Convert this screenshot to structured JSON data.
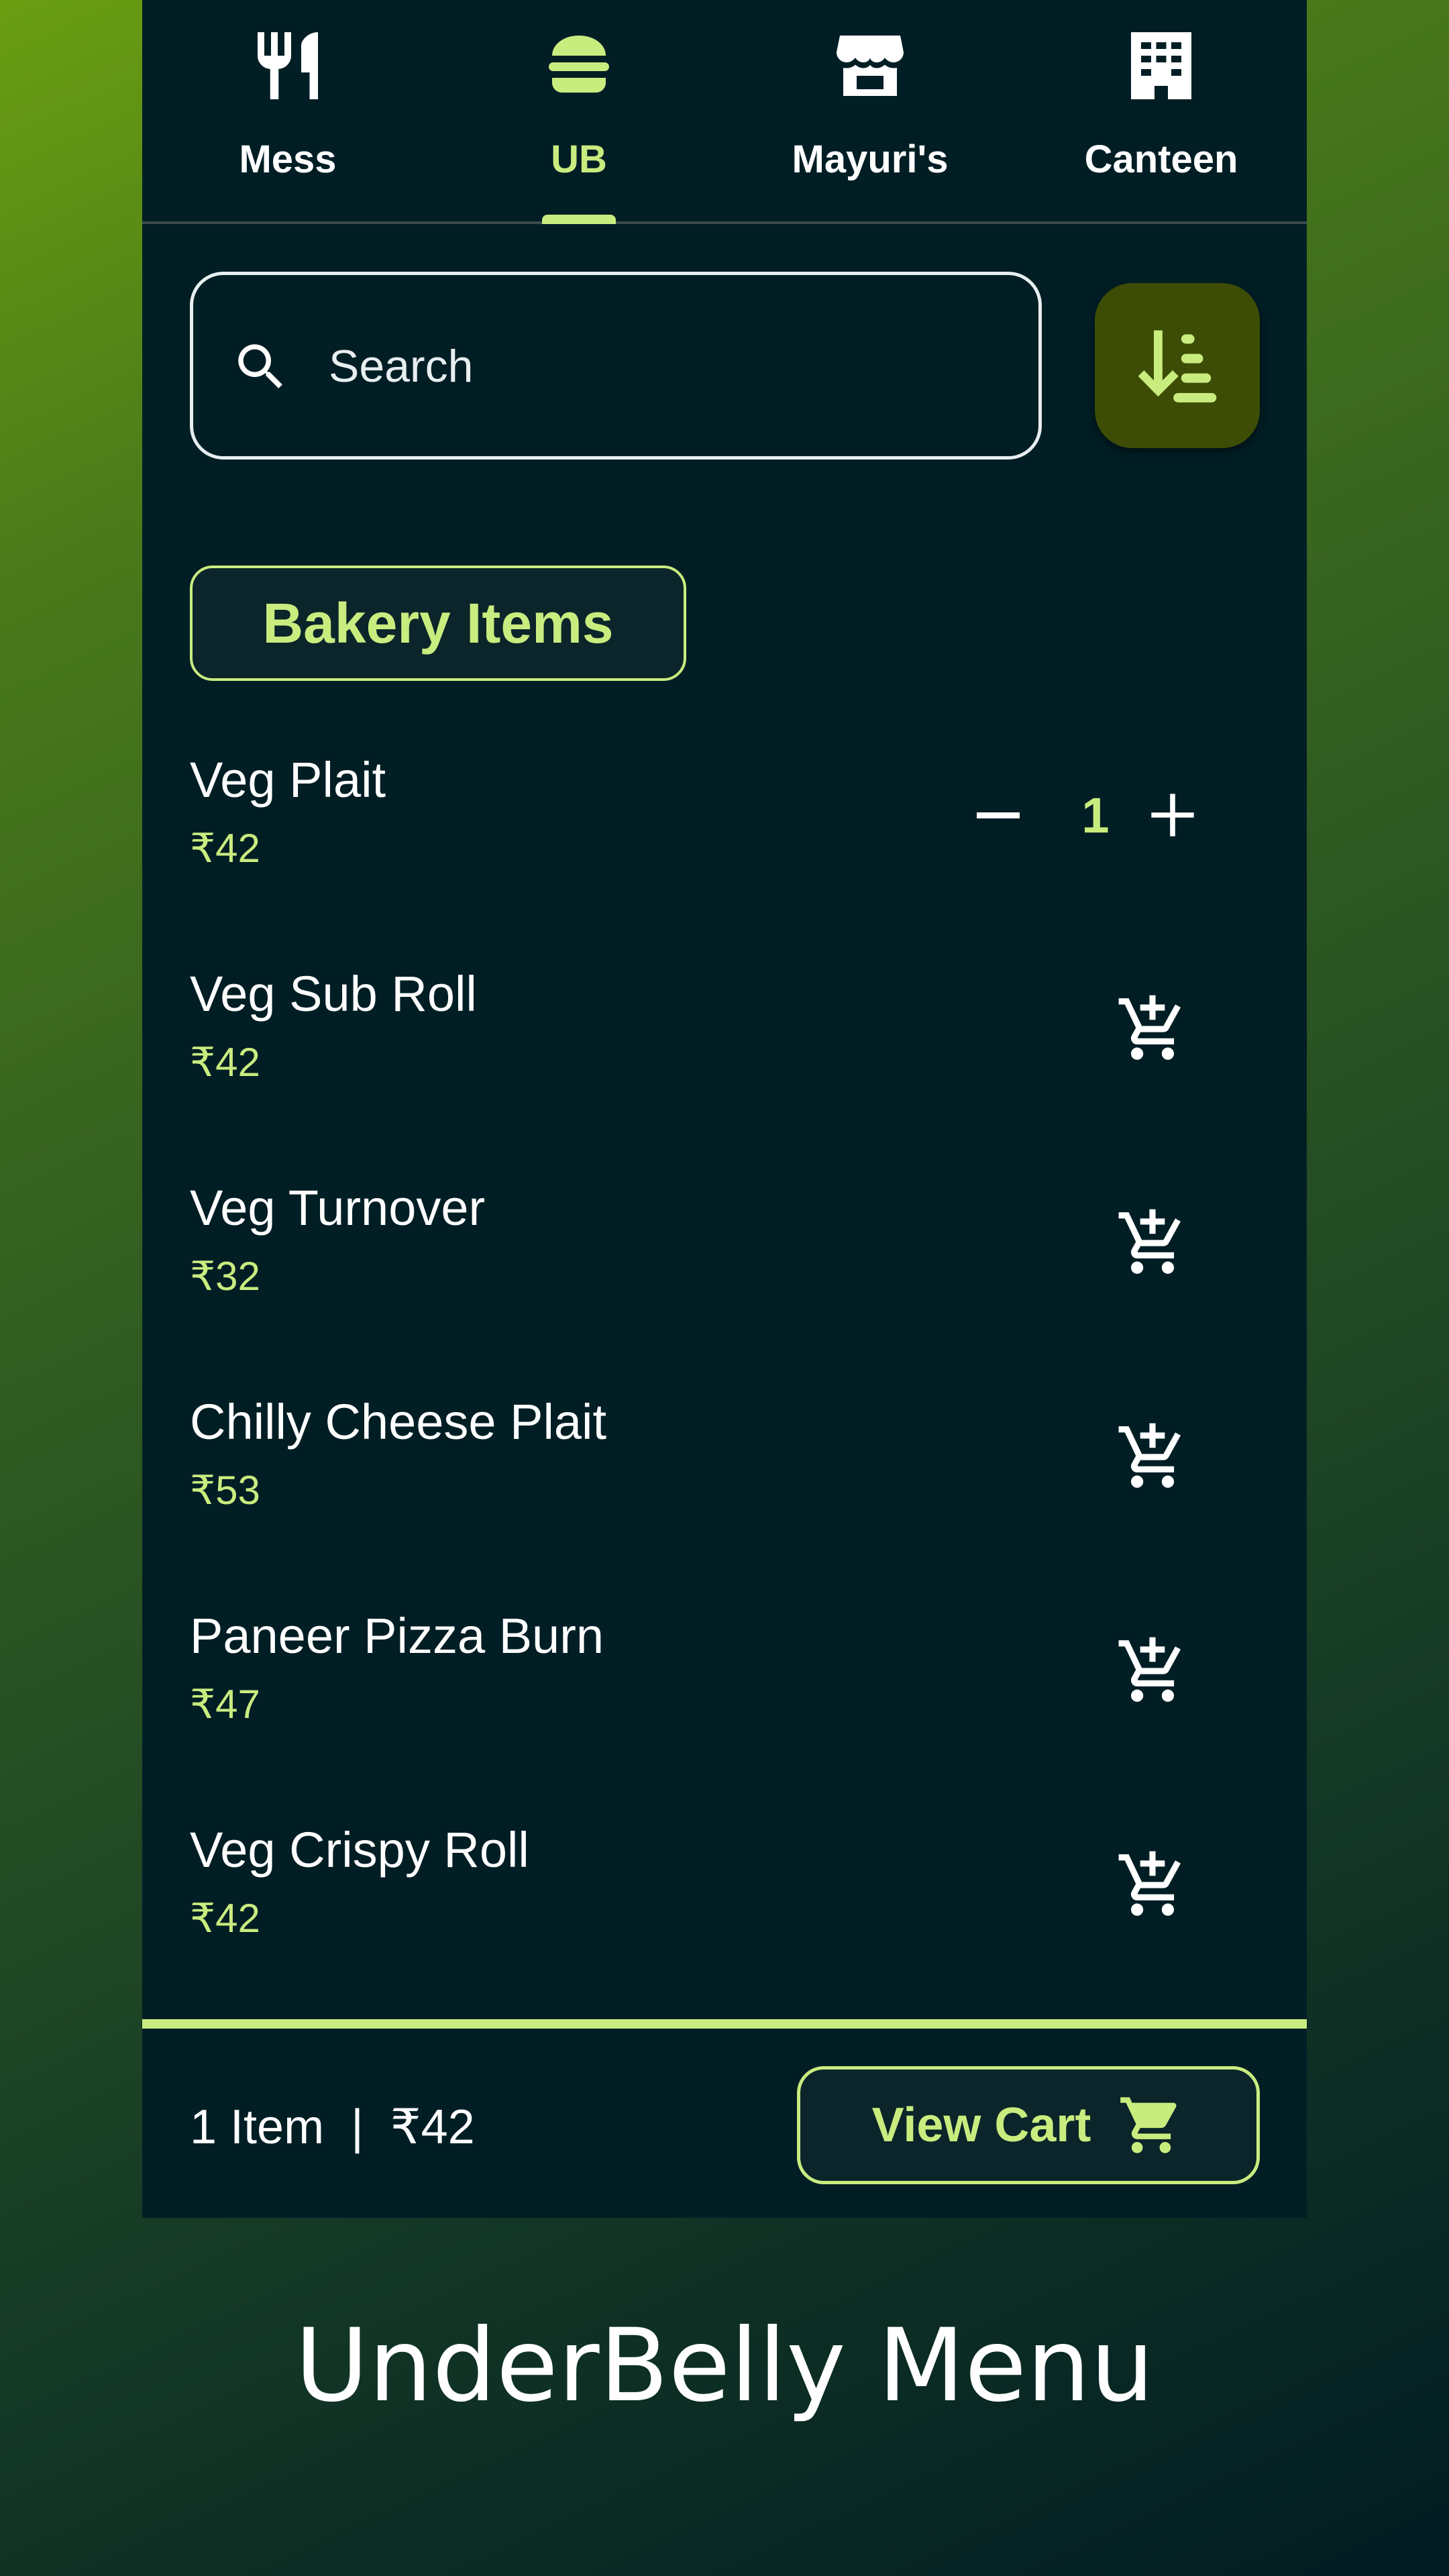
{
  "tabs": [
    {
      "label": "Mess",
      "icon": "fork-knife-icon",
      "active": false
    },
    {
      "label": "UB",
      "icon": "burger-icon",
      "active": true
    },
    {
      "label": "Mayuri's",
      "icon": "storefront-icon",
      "active": false
    },
    {
      "label": "Canteen",
      "icon": "building-icon",
      "active": false
    }
  ],
  "search": {
    "placeholder": "Search",
    "icon": "search-icon"
  },
  "sort_button": {
    "icon": "sort-descending-icon"
  },
  "category": {
    "label": "Bakery Items"
  },
  "items": [
    {
      "name": "Veg Plait",
      "price": "₹42",
      "quantity": "1"
    },
    {
      "name": "Veg Sub Roll",
      "price": "₹42"
    },
    {
      "name": "Veg Turnover",
      "price": "₹32"
    },
    {
      "name": "Chilly Cheese Plait",
      "price": "₹53"
    },
    {
      "name": "Paneer Pizza Burn",
      "price": "₹47"
    },
    {
      "name": "Veg Crispy Roll",
      "price": "₹42"
    }
  ],
  "cart": {
    "summary": "1 Item  |  ₹42",
    "button_label": "View Cart",
    "icon": "shopping-cart-icon"
  },
  "caption": "UnderBelly Menu",
  "colors": {
    "accent": "#c9ec7f",
    "panel": "#011e25",
    "sort_button_bg": "#3d4d05",
    "text": "#ffffff"
  }
}
